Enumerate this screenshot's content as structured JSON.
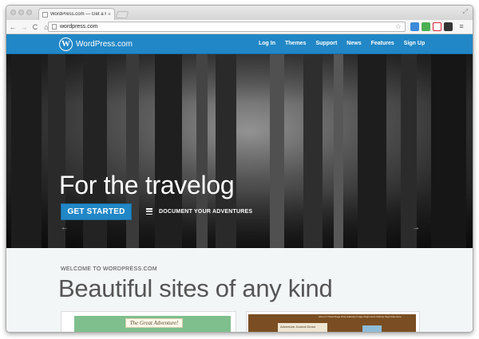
{
  "browser": {
    "tab_title": "WordPress.com — Get a Fre",
    "tab_close": "×",
    "url": "wordpress.com",
    "back": "←",
    "forward": "→",
    "reload": "C",
    "home": "⌂",
    "star": "☆",
    "menu": "≡",
    "resize": "⤢"
  },
  "site": {
    "logo_mark": "W",
    "logo_text": "WordPress.com",
    "nav": [
      "Log In",
      "Themes",
      "Support",
      "News",
      "Features",
      "Sign Up"
    ]
  },
  "hero": {
    "title": "For the travelog",
    "cta": "GET STARTED",
    "secondary": "DOCUMENT YOUR ADVENTURES",
    "prev": "←",
    "next": "→"
  },
  "main": {
    "eyebrow": "WELCOME TO WORDPRESS.COM",
    "headline": "Beautiful sites of any kind",
    "card1_banner": "The Great Adventure!",
    "card2_title": "Adventure Journal Demo",
    "card2_nav": "About  A Travel Page  FAQ  Galleries  Image Alignments  Markup  Tags  Adventure"
  },
  "colors": {
    "brand_blue": "#2187c6",
    "hero_dark": "#1a1a1a"
  }
}
